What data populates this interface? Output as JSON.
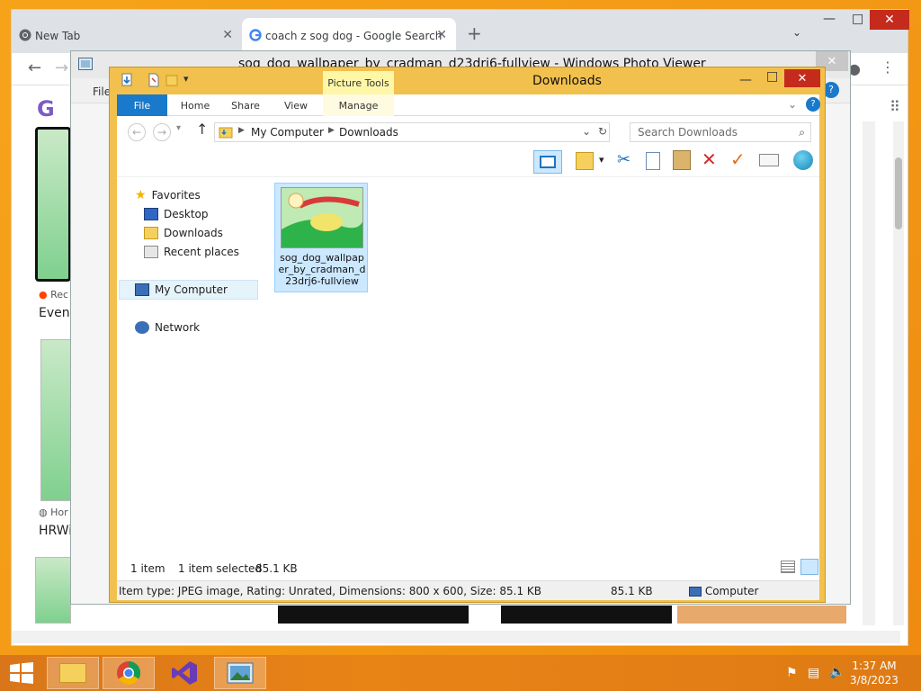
{
  "chrome": {
    "tabs": [
      {
        "label": "New Tab"
      },
      {
        "label": "coach z sog dog - Google Search"
      }
    ],
    "results": [
      {
        "source": "Rec",
        "caption": "Even"
      },
      {
        "source": "Hor",
        "caption": "HRWi"
      }
    ],
    "partial_logo": "G"
  },
  "photo_viewer": {
    "title": "sog_dog_wallpaper_by_cradman_d23dri6-fullview - Windows Photo Viewer",
    "menu_file": "File"
  },
  "explorer": {
    "title": "Downloads",
    "contextual_tab": "Picture Tools",
    "ribbon_tabs": [
      "File",
      "Home",
      "Share",
      "View",
      "Manage"
    ],
    "breadcrumb": [
      "My Computer",
      "Downloads"
    ],
    "search_placeholder": "Search Downloads",
    "nav": {
      "favorites": "Favorites",
      "desktop": "Desktop",
      "downloads": "Downloads",
      "recent": "Recent places",
      "computer": "My Computer",
      "network": "Network"
    },
    "file": {
      "name": "sog_dog_wallpaper_by_cradman_d23drj6-fullview"
    },
    "status": {
      "count": "1 item",
      "selected": "1 item selected",
      "size": "85.1 KB"
    },
    "details": {
      "info": "Item type: JPEG image, Rating: Unrated, Dimensions: 800 x 600, Size: 85.1 KB",
      "size": "85.1 KB",
      "location": "Computer"
    }
  },
  "taskbar": {
    "time": "1:37 AM",
    "date": "3/8/2023"
  },
  "colors": {
    "accent": "#1979ca",
    "selection": "#cce8ff",
    "window_frame": "#f2c04c",
    "desktop": "#f39a16"
  }
}
